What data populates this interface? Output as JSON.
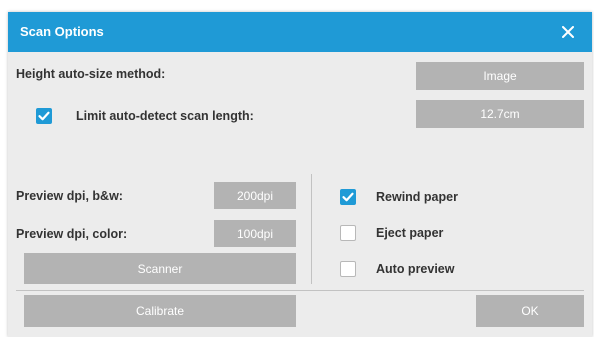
{
  "dialog": {
    "title": "Scan Options",
    "close_glyph": "✕"
  },
  "height_auto_size": {
    "label": "Height auto-size method:",
    "value": "Image"
  },
  "limit_scan_length": {
    "label": "Limit auto-detect scan length:",
    "checked": true,
    "value": "12.7cm"
  },
  "preview_bw": {
    "label": "Preview dpi, b&w:",
    "value": "200dpi"
  },
  "preview_color": {
    "label": "Preview dpi, color:",
    "value": "100dpi"
  },
  "scanner_button": "Scanner",
  "options": {
    "rewind": {
      "label": "Rewind paper",
      "checked": true
    },
    "eject": {
      "label": "Eject paper",
      "checked": false
    },
    "auto_preview": {
      "label": "Auto preview",
      "checked": false
    }
  },
  "calibrate_button": "Calibrate",
  "ok_button": "OK",
  "colors": {
    "accent": "#1f9ad6",
    "button": "#b3b3b3",
    "panel": "#ececec"
  },
  "icons": {
    "close": "close-icon",
    "check": "checkmark-icon"
  }
}
